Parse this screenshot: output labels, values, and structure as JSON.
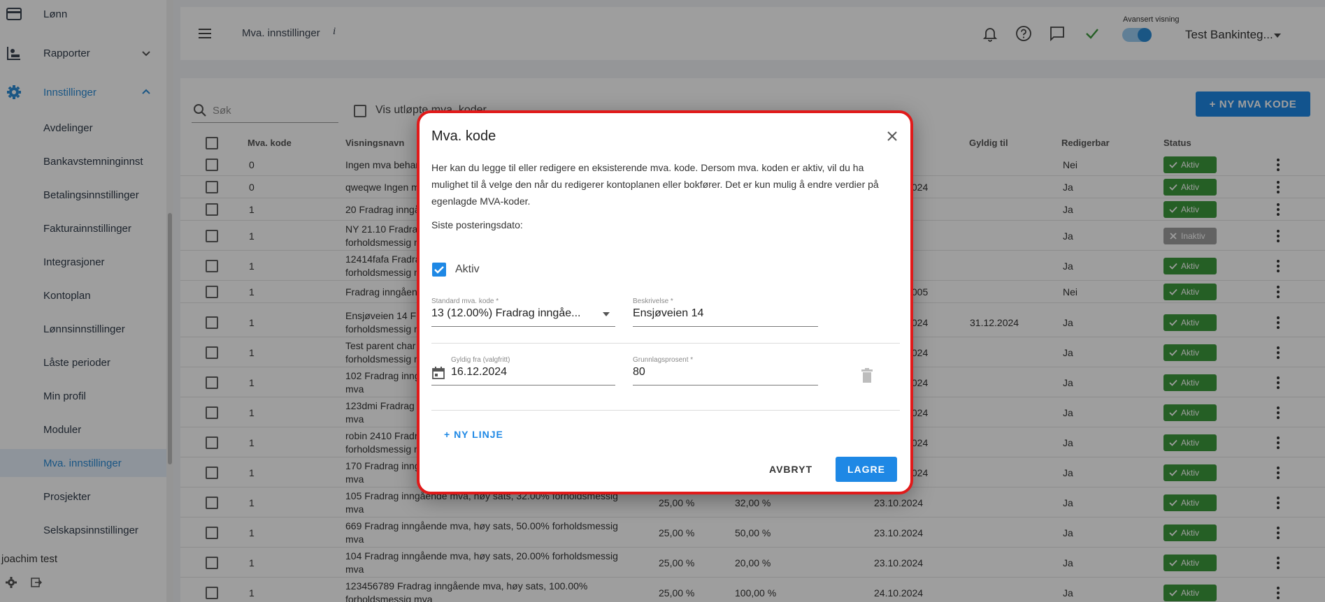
{
  "sidebar": {
    "items": [
      {
        "label": "Lønn",
        "icon": "card-icon"
      },
      {
        "label": "Rapporter",
        "icon": "report-icon"
      },
      {
        "label": "Innstillinger",
        "icon": "gear-icon"
      },
      {
        "label": "Avdelinger"
      },
      {
        "label": "Bankavstemninginnst"
      },
      {
        "label": "Betalingsinnstillinger"
      },
      {
        "label": "Fakturainnstillinger"
      },
      {
        "label": "Integrasjoner"
      },
      {
        "label": "Kontoplan"
      },
      {
        "label": "Lønnsinnstillinger"
      },
      {
        "label": "Låste perioder"
      },
      {
        "label": "Min profil"
      },
      {
        "label": "Moduler"
      },
      {
        "label": "Mva. innstillinger"
      },
      {
        "label": "Prosjekter"
      },
      {
        "label": "Selskapsinnstillinger"
      }
    ],
    "user": "joachim test"
  },
  "header": {
    "title": "Mva. innstillinger",
    "info": "i",
    "advanced_label": "Avansert visning",
    "company": "Test Bankinteg..."
  },
  "toolbar": {
    "search_placeholder": "Søk",
    "show_expired": "Vis utløpte mva. koder",
    "new_button": "+ NY MVA KODE"
  },
  "table": {
    "headers": [
      "Mva. kode",
      "Visningsnavn",
      "Gyldig til",
      "Redigerbar",
      "Status"
    ],
    "rows": [
      {
        "code": "0",
        "name": [
          "Ingen mva behan"
        ],
        "c4": "",
        "c5": "",
        "c6": "",
        "until": "",
        "edit": "Nei",
        "status": "Aktiv"
      },
      {
        "code": "0",
        "name": [
          "qweqwe Ingen m"
        ],
        "c4": "",
        "c5": "",
        "c6": ".024",
        "until": "",
        "edit": "Ja",
        "status": "Aktiv"
      },
      {
        "code": "1",
        "name": [
          "20 Fradrag inngå"
        ],
        "c4": "",
        "c5": "",
        "c6": "",
        "until": "",
        "edit": "Ja",
        "status": "Aktiv"
      },
      {
        "code": "1",
        "name": [
          "NY 21.10 Fradrag",
          "forholdsmessig n"
        ],
        "c4": "",
        "c5": "",
        "c6": "",
        "until": "",
        "edit": "Ja",
        "status": "Inaktiv"
      },
      {
        "code": "1",
        "name": [
          "12414fafa Fradra",
          "forholdsmessig n"
        ],
        "c4": "",
        "c5": "",
        "c6": "",
        "until": "",
        "edit": "Ja",
        "status": "Aktiv"
      },
      {
        "code": "1",
        "name": [
          "Fradrag inngåen"
        ],
        "c4": "",
        "c5": "",
        "c6": ".005",
        "until": "",
        "edit": "Nei",
        "status": "Aktiv"
      },
      {
        "code": "1",
        "name": [
          "Ensjøveien 14 Fr",
          "forholdsmessig n"
        ],
        "c4": "",
        "c5": "",
        "c6": ".024",
        "until": "31.12.2024",
        "edit": "Ja",
        "status": "Aktiv"
      },
      {
        "code": "1",
        "name": [
          "Test parent char",
          "forholdsmessig n"
        ],
        "c4": "",
        "c5": "",
        "c6": ".024",
        "until": "",
        "edit": "Ja",
        "status": "Aktiv"
      },
      {
        "code": "1",
        "name": [
          "102 Fradrag inng",
          "mva"
        ],
        "c4": "",
        "c5": "",
        "c6": ".024",
        "until": "",
        "edit": "Ja",
        "status": "Aktiv"
      },
      {
        "code": "1",
        "name": [
          "123dmi Fradrag",
          "mva"
        ],
        "c4": "",
        "c5": "",
        "c6": ".024",
        "until": "",
        "edit": "Ja",
        "status": "Aktiv"
      },
      {
        "code": "1",
        "name": [
          "robin 2410 Fradr",
          "forholdsmessig n"
        ],
        "c4": "",
        "c5": "",
        "c6": ".024",
        "until": "",
        "edit": "Ja",
        "status": "Aktiv"
      },
      {
        "code": "1",
        "name": [
          "170 Fradrag inng",
          "mva"
        ],
        "c4": "",
        "c5": "",
        "c6": ".024",
        "until": "",
        "edit": "Ja",
        "status": "Aktiv"
      },
      {
        "code": "1",
        "name": [
          "105 Fradrag inngående mva, høy sats, 32.00% forholdsmessig",
          "mva"
        ],
        "c4": "25,00 %",
        "c5": "32,00 %",
        "c6": "23.10.2024",
        "until": "",
        "edit": "Ja",
        "status": "Aktiv"
      },
      {
        "code": "1",
        "name": [
          "669 Fradrag inngående mva, høy sats, 50.00% forholdsmessig",
          "mva"
        ],
        "c4": "25,00 %",
        "c5": "50,00 %",
        "c6": "23.10.2024",
        "until": "",
        "edit": "Ja",
        "status": "Aktiv"
      },
      {
        "code": "1",
        "name": [
          "104 Fradrag inngående mva, høy sats, 20.00% forholdsmessig",
          "mva"
        ],
        "c4": "25,00 %",
        "c5": "20,00 %",
        "c6": "23.10.2024",
        "until": "",
        "edit": "Ja",
        "status": "Aktiv"
      },
      {
        "code": "1",
        "name": [
          "123456789 Fradrag inngående mva, høy sats, 100.00%",
          "forholdsmessig mva"
        ],
        "c4": "25,00 %",
        "c5": "100,00 %",
        "c6": "24.10.2024",
        "until": "",
        "edit": "Ja",
        "status": "Aktiv"
      }
    ]
  },
  "dialog": {
    "title": "Mva. kode",
    "description": "Her kan du legge til eller redigere en eksisterende mva. kode. Dersom mva. koden er aktiv, vil du ha mulighet til å velge den når du redigerer kontoplanen eller bokfører. Det er kun mulig å endre verdier på egenlagde MVA-koder.",
    "last_posting_label": "Siste posteringsdato:",
    "active_label": "Aktiv",
    "standard_code_label": "Standard mva. kode *",
    "standard_code_value": "13 (12.00%) Fradrag inngåe...",
    "description_label": "Beskrivelse *",
    "description_value": "Ensjøveien 14",
    "valid_from_label": "Gyldig fra (valgfritt)",
    "valid_from_value": "16.12.2024",
    "base_percent_label": "Grunnlagsprosent *",
    "base_percent_value": "80",
    "new_line": "+ NY LINJE",
    "cancel": "AVBRYT",
    "save": "LAGRE"
  },
  "colors": {
    "accent": "#1e88e5",
    "active": "#3c9a3c",
    "inactive": "#9e9e9e",
    "highlight_border": "#e11a1a"
  }
}
